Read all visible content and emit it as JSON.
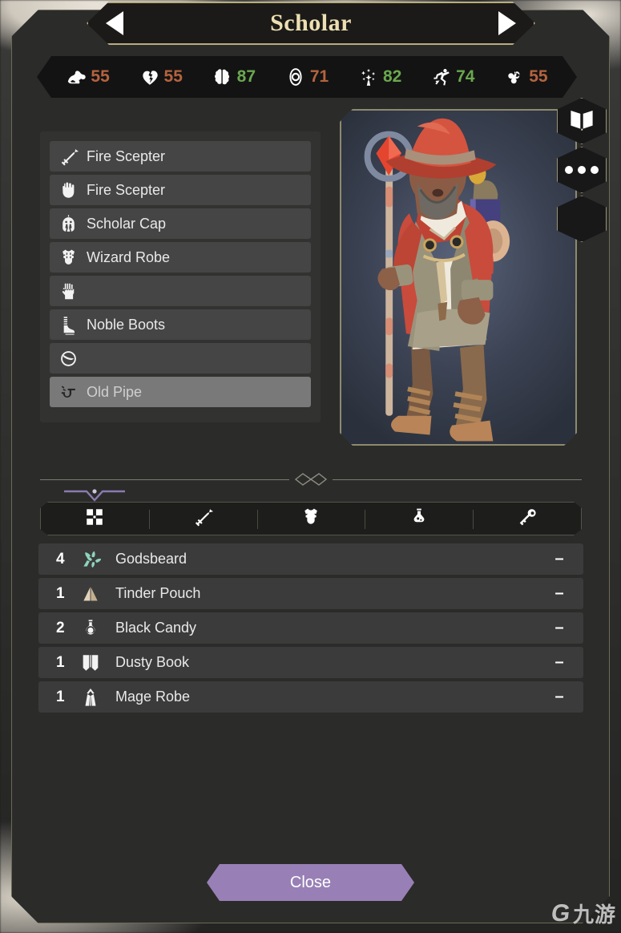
{
  "header": {
    "title": "Scholar",
    "prev_label": "◀",
    "next_label": "▶"
  },
  "stats": [
    {
      "icon": "strength-icon",
      "value": "55",
      "color": "#b5633f"
    },
    {
      "icon": "health-icon",
      "value": "55",
      "color": "#b5633f"
    },
    {
      "icon": "intellect-icon",
      "value": "87",
      "color": "#6aa84f"
    },
    {
      "icon": "perception-icon",
      "value": "71",
      "color": "#b5633f"
    },
    {
      "icon": "magic-icon",
      "value": "82",
      "color": "#6aa84f"
    },
    {
      "icon": "agility-icon",
      "value": "74",
      "color": "#6aa84f"
    },
    {
      "icon": "luck-icon",
      "value": "55",
      "color": "#b5633f"
    }
  ],
  "equipment": [
    {
      "icon": "sword-icon",
      "label": "Fire Scepter",
      "highlight": false
    },
    {
      "icon": "fist-icon",
      "label": "Fire Scepter",
      "highlight": false
    },
    {
      "icon": "helmet-icon",
      "label": "Scholar Cap",
      "highlight": false
    },
    {
      "icon": "chest-icon",
      "label": "Wizard Robe",
      "highlight": false
    },
    {
      "icon": "glove-icon",
      "label": "",
      "highlight": false
    },
    {
      "icon": "boot-icon",
      "label": "Noble Boots",
      "highlight": false
    },
    {
      "icon": "ring-icon",
      "label": "",
      "highlight": false
    },
    {
      "icon": "pipe-icon",
      "label": "Old Pipe",
      "highlight": true
    }
  ],
  "side_buttons": [
    {
      "icon": "book-icon",
      "label": ""
    },
    {
      "icon": "more-icon",
      "label": ""
    },
    {
      "icon": "blank-icon",
      "label": ""
    }
  ],
  "tabs": [
    {
      "icon": "backpack-icon",
      "active": true
    },
    {
      "icon": "sword-icon",
      "active": false
    },
    {
      "icon": "armor-icon",
      "active": false
    },
    {
      "icon": "potion-icon",
      "active": false
    },
    {
      "icon": "key-tools-icon",
      "active": false
    }
  ],
  "inventory": {
    "remove_label": "–",
    "items": [
      {
        "qty": "4",
        "icon": "herb-icon",
        "name": "Godsbeard",
        "color": "#8fd4bd"
      },
      {
        "qty": "1",
        "icon": "pouch-icon",
        "name": "Tinder Pouch",
        "color": "#d9cbb0"
      },
      {
        "qty": "2",
        "icon": "flask-icon",
        "name": "Black Candy",
        "color": "#f2f2f2"
      },
      {
        "qty": "1",
        "icon": "book-icon",
        "name": "Dusty Book",
        "color": "#f2f2f2"
      },
      {
        "qty": "1",
        "icon": "robe-icon",
        "name": "Mage Robe",
        "color": "#f2f2f2"
      }
    ]
  },
  "footer": {
    "close_label": "Close"
  },
  "watermark": {
    "mark": "G",
    "text": "九游"
  },
  "colors": {
    "accent_purple": "#9880b6",
    "gold_border": "#b8ad7e",
    "title_text": "#ecdfb2",
    "stat_green": "#6aa84f",
    "stat_orange": "#b5633f"
  }
}
